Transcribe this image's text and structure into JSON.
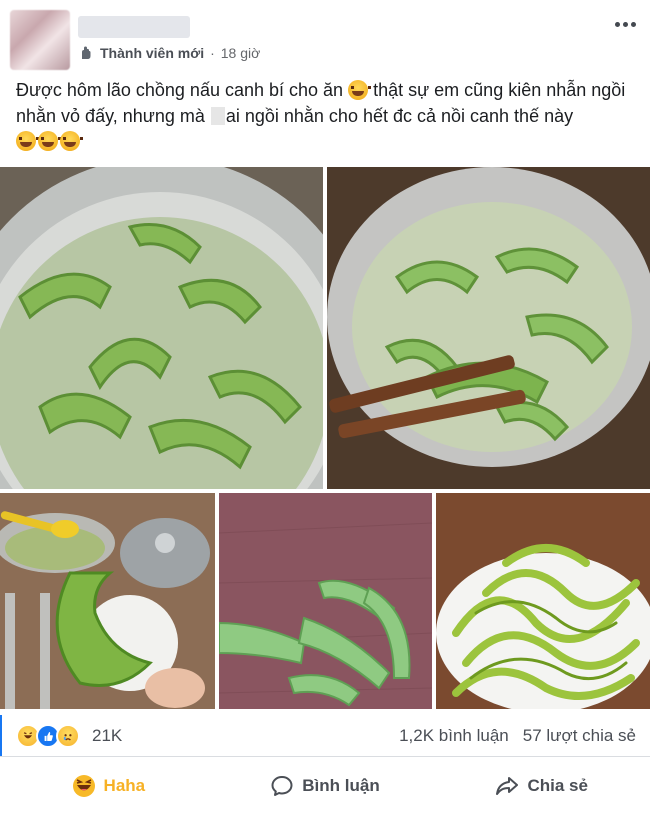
{
  "post": {
    "author_name": "",
    "badge": "Thành viên mới",
    "separator": "·",
    "time": "18 giờ",
    "caption_part1": "Được hôm lão chồng nấu canh bí cho ăn",
    "caption_part2": " thật sự em cũng kiên nhẫn ngồi nhằn vỏ đấy, nhưng mà ",
    "caption_part3": "ai ngồi nhằn cho hết đc cả nồi canh thế này"
  },
  "icons": {
    "more": "more-icon",
    "wave": "member-wave-icon",
    "haha": "haha-icon",
    "comment": "comment-icon",
    "share": "share-icon"
  },
  "reactions": {
    "count": "21K",
    "comments": "1,2K bình luận",
    "shares": "57 lượt chia sẻ"
  },
  "actions": {
    "haha_label": "Haha",
    "comment_label": "Bình luận",
    "share_label": "Chia sẻ"
  },
  "colors": {
    "haha_active": "#f7b125",
    "like_blue": "#1877f2",
    "meta_gray": "#65676b"
  }
}
